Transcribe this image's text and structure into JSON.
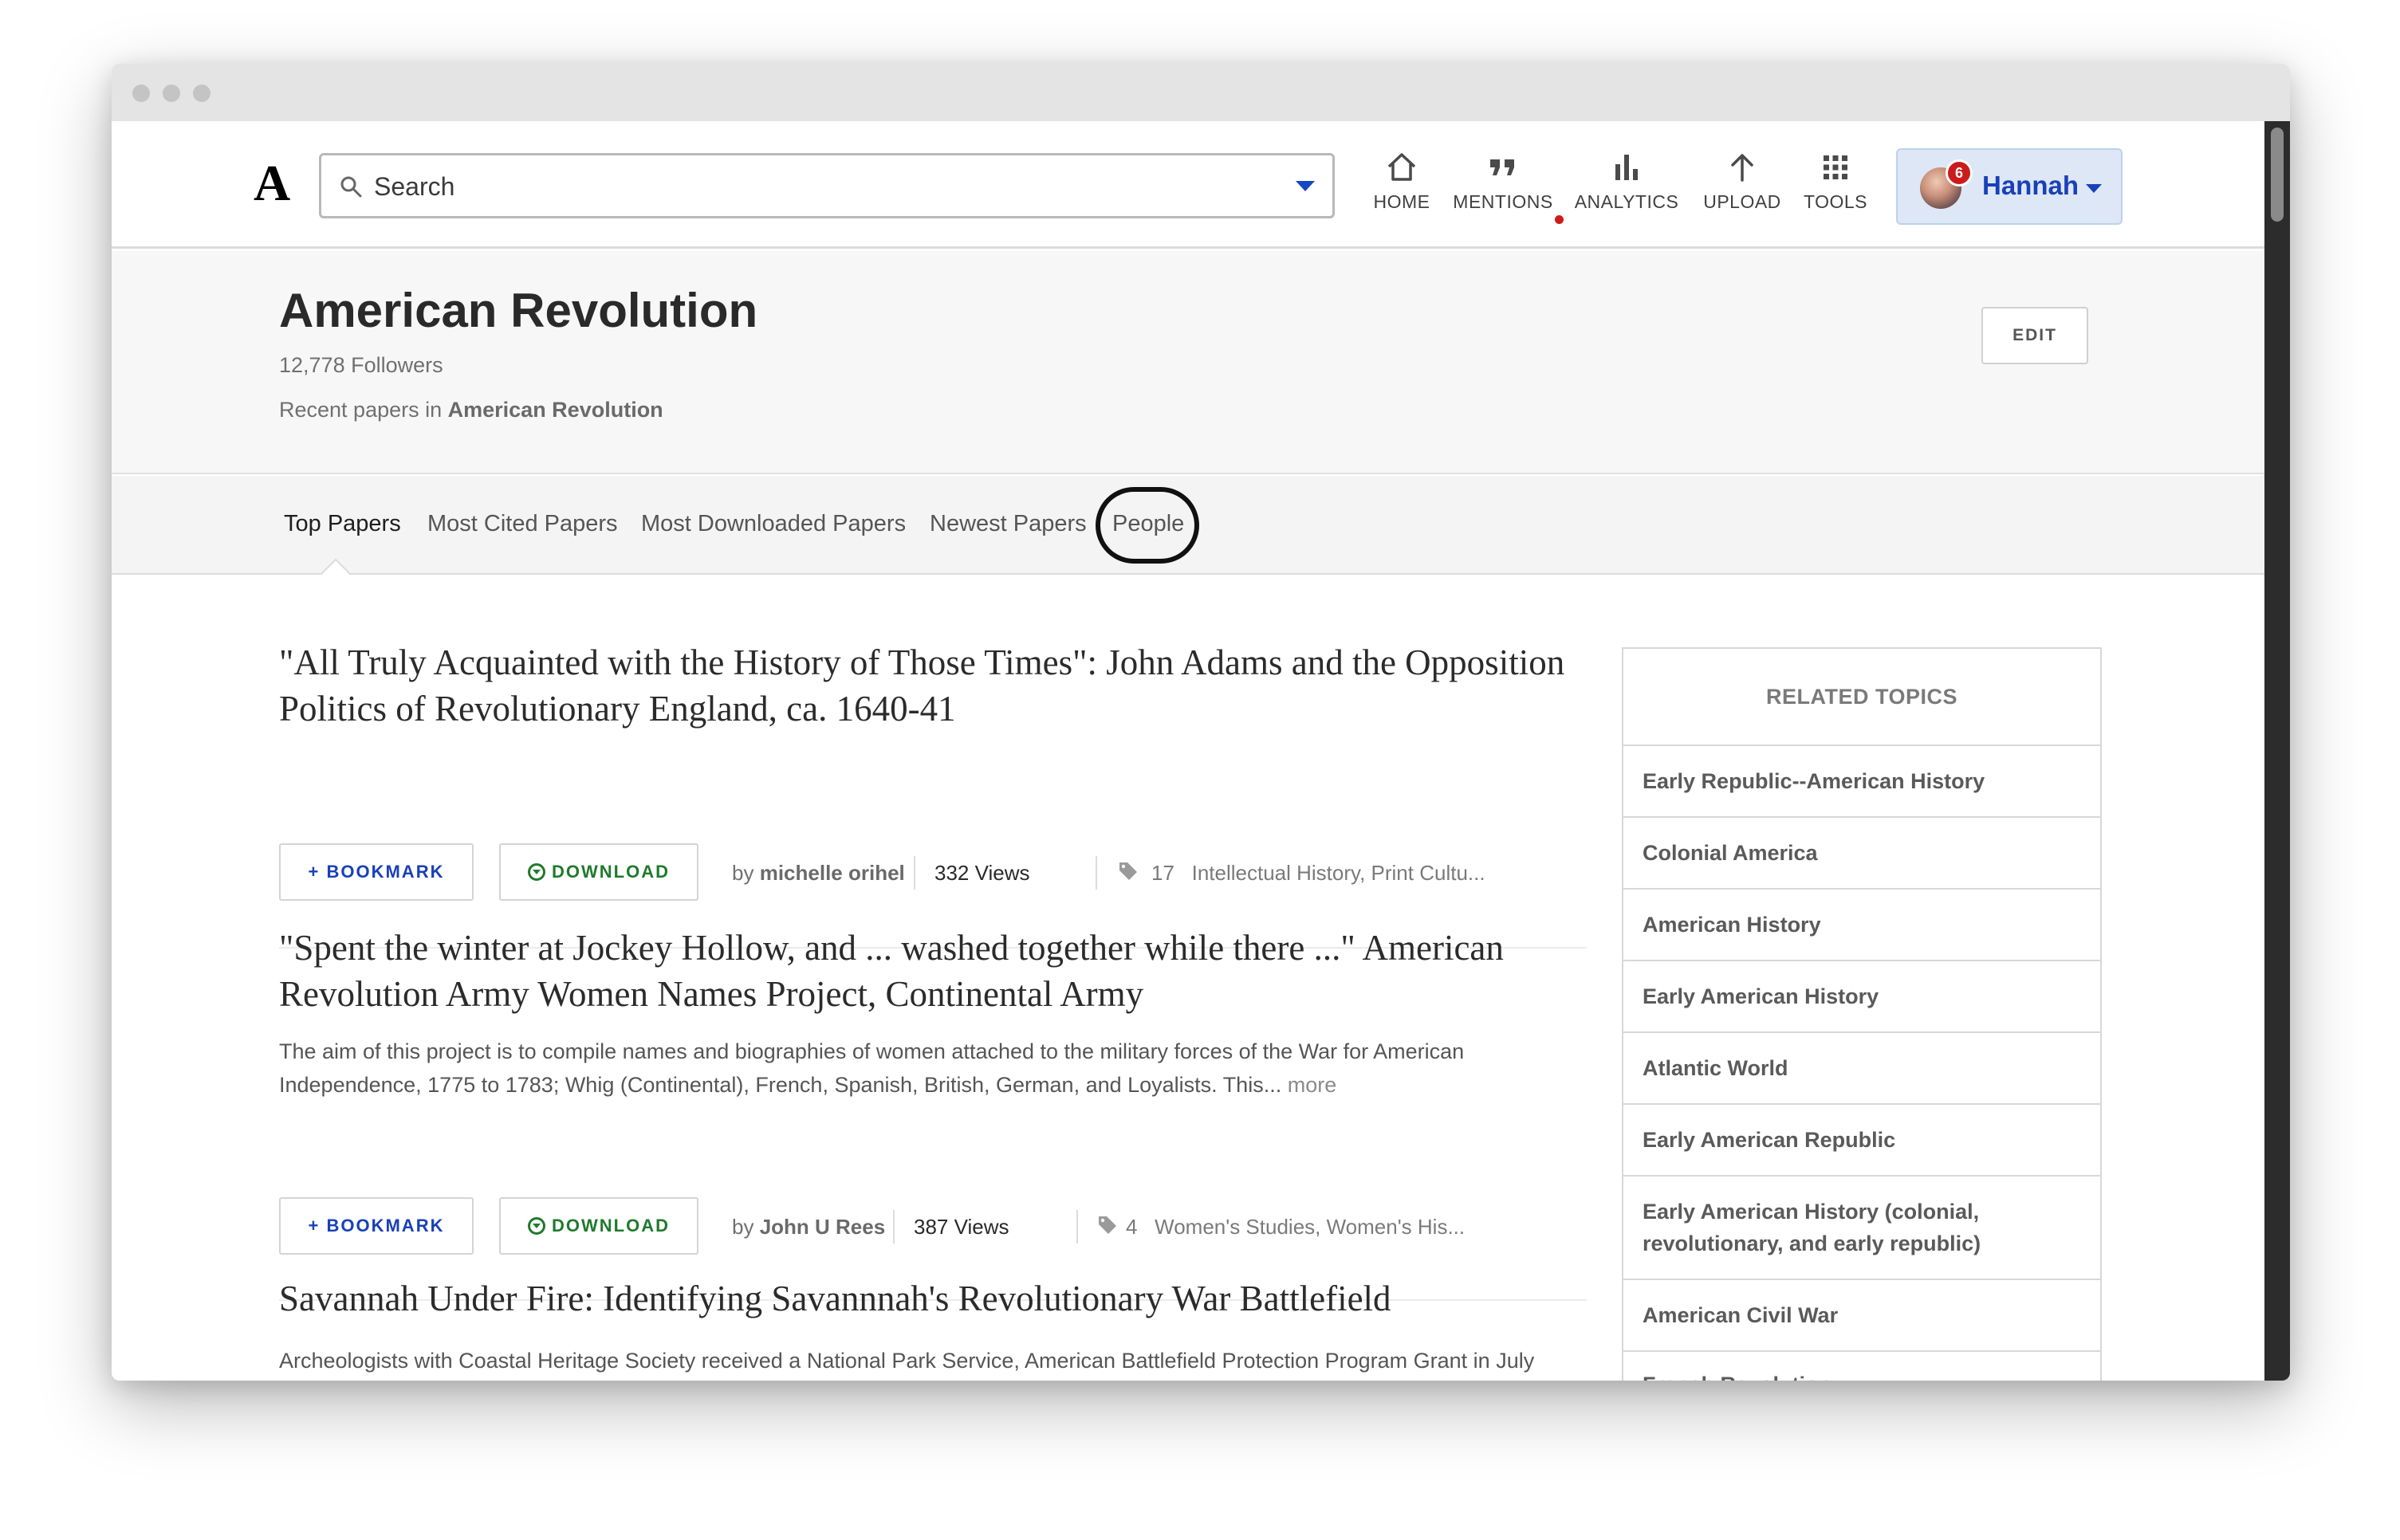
{
  "header": {
    "logo": "A",
    "search_placeholder": "Search",
    "nav": [
      {
        "label": "HOME",
        "icon": "home-icon"
      },
      {
        "label": "MENTIONS",
        "icon": "quote-icon",
        "has_notification": true
      },
      {
        "label": "ANALYTICS",
        "icon": "bar-chart-icon"
      },
      {
        "label": "UPLOAD",
        "icon": "upload-arrow-icon"
      },
      {
        "label": "TOOLS",
        "icon": "grid-icon"
      }
    ],
    "user": {
      "name": "Hannah",
      "notification_count": "6"
    }
  },
  "topic": {
    "title": "American Revolution",
    "followers": "12,778 Followers",
    "recent_prefix": "Recent papers in ",
    "recent_topic": "American Revolution",
    "edit_label": "EDIT"
  },
  "tabs": [
    {
      "label": "Top Papers",
      "active": true
    },
    {
      "label": "Most Cited Papers"
    },
    {
      "label": "Most Downloaded Papers"
    },
    {
      "label": "Newest Papers"
    },
    {
      "label": "People",
      "highlighted": true
    }
  ],
  "papers": [
    {
      "title": "\"All Truly Acquainted with the History of Those Times\": John Adams and the Opposition Politics of Revolutionary England, ca. 1640-41",
      "abstract": "",
      "bookmark_label": "BOOKMARK",
      "download_label": "DOWNLOAD",
      "author_prefix": "by",
      "author": "michelle orihel",
      "views": "332 Views",
      "tag_count": "17",
      "tags": "Intellectual History, Print Cultu..."
    },
    {
      "title": "\"Spent the winter at Jockey Hollow, and ... washed together while there ...\" American Revolution Army Women Names Project, Continental Army",
      "abstract": "The aim of this project is to compile names and biographies of women attached to the military forces of the War for American Independence, 1775 to 1783; Whig (Continental), French, Spanish, British, German, and Loyalists. This...",
      "more_label": "more",
      "bookmark_label": "BOOKMARK",
      "download_label": "DOWNLOAD",
      "author_prefix": "by",
      "author": "John U Rees",
      "views": "387 Views",
      "tag_count": "4",
      "tags": "Women's Studies, Women's His..."
    },
    {
      "title": "Savannah Under Fire: Identifying Savannnah's Revolutionary War Battlefield",
      "abstract": "Archeologists with Coastal Heritage Society received a National Park Service, American Battlefield Protection Program Grant in July"
    }
  ],
  "related_topics": {
    "heading": "RELATED TOPICS",
    "items": [
      "Early Republic--American History",
      "Colonial America",
      "American History",
      "Early American History",
      "Atlantic World",
      "Early American Republic",
      "Early American History (colonial, revolutionary, and early republic)",
      "American Civil War",
      "French Revolution"
    ]
  },
  "colors": {
    "accent_blue": "#1a40b8",
    "download_green": "#1f7a2c",
    "notification_red": "#cc1b1b",
    "user_button_bg": "#dde7f5"
  }
}
